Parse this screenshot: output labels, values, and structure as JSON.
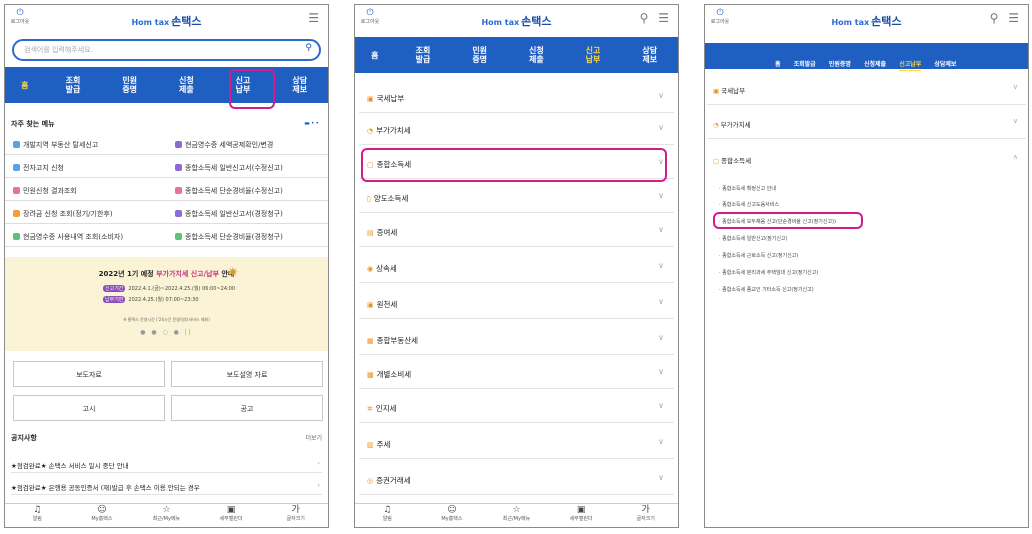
{
  "screen1": {
    "login_label": "로그아웃",
    "logo_text": "손택스",
    "logo_hometax": "Hom tax",
    "search_placeholder": "검색어를 입력해주세요.",
    "nav": [
      {
        "label": "홈"
      },
      {
        "label": "조회\n발급"
      },
      {
        "label": "민원\n증명"
      },
      {
        "label": "신청\n제출"
      },
      {
        "label": "신고\n납부"
      },
      {
        "label": "상담\n제보"
      }
    ],
    "frequent_title": "자주 찾는 메뉴",
    "frequent_menu": [
      {
        "label": "개발지역 부동산 탈세신고",
        "color": "#5aa0e6"
      },
      {
        "label": "현금영수증 세액공제확인/변경",
        "color": "#8c6bd6"
      },
      {
        "label": "전자고지 신청",
        "color": "#5aa0e6"
      },
      {
        "label": "종합소득세 일반신고서(수정신고)",
        "color": "#8c6bd6"
      },
      {
        "label": "민원신청 결과조회",
        "color": "#e86fa4"
      },
      {
        "label": "종합소득세 단순경비율(수정신고)",
        "color": "#e86fa4"
      },
      {
        "label": "장려금 신청 조회(정기/기한후)",
        "color": "#f0a040"
      },
      {
        "label": "종합소득세 일반신고서(경정청구)",
        "color": "#8c6bd6"
      },
      {
        "label": "현금영수증 사용내역 조회(소비자)",
        "color": "#5ec07a"
      },
      {
        "label": "종합소득세 단순경비율(경정청구)",
        "color": "#5ec07a"
      }
    ],
    "banner": {
      "title_prefix": "2022년 1기 예정 ",
      "title_highlight": "부가가치세 신고/납부",
      "title_suffix": " 안내",
      "line1_tag": "신고기간",
      "line1": "2022.4.1.(금)~2022.4.25.(월) 06:00~24:00",
      "line2_tag": "납부기한",
      "line2": "2022.4.25.(월) 07:00~23:30",
      "note": "※ 홈택스 운영시간 ('24시간 운영/일부서비스 제외)",
      "pager": "● ● ○ ● ||"
    },
    "buttons": [
      "보도자료",
      "보도설명 자료",
      "고시",
      "공고"
    ],
    "notice_title": "공지사항",
    "notice_more": "더보기",
    "notices": [
      "★점검완료★ 손택스 서비스 일시 중단 안내",
      "★점검완료★ 은행용 공동인증서 (재)발급 후 손택스 이용 안되는 경우"
    ]
  },
  "screen2": {
    "login_label": "로그아웃",
    "logo_text": "손택스",
    "logo_hometax": "Hom tax",
    "nav": [
      {
        "label": "홈"
      },
      {
        "label": "조회\n발급"
      },
      {
        "label": "민원\n증명"
      },
      {
        "label": "신청\n제출"
      },
      {
        "label": "신고\n납부"
      },
      {
        "label": "상담\n제보"
      }
    ],
    "items": [
      "국세납부",
      "부가가치세",
      "종합소득세",
      "양도소득세",
      "증여세",
      "상속세",
      "원천세",
      "종합부동산세",
      "개별소비세",
      "인지세",
      "주세",
      "증권거래세"
    ]
  },
  "screen3": {
    "login_label": "로그아웃",
    "logo_text": "손택스",
    "logo_hometax": "Hom tax",
    "nav": [
      "홈",
      "조회발급",
      "민원증명",
      "신청제출",
      "신고납부",
      "상담제보"
    ],
    "items": [
      "국세납부",
      "부가가치세",
      "종합소득세"
    ],
    "sub_items": [
      "· 종합소득세 확정신고 안내",
      "· 종합소득세 신고도움서비스",
      "· 종합소득세 모두채움 신고(단순경비율 신고(정기신고))",
      "· 종합소득세 일반신고(정기신고)",
      "· 종합소득세 근로소득 신고(정기신고)",
      "· 종합소득세 분리과세 주택임대 신고(정기신고)",
      "· 종합소득세 종교인 기타소득 신고(정기신고)"
    ]
  },
  "bottom_nav": [
    {
      "icon": "bell-icon",
      "label": "알림"
    },
    {
      "icon": "person-icon",
      "label": "My홈택스"
    },
    {
      "icon": "star-icon",
      "label": "최근/My메뉴"
    },
    {
      "icon": "calendar-icon",
      "label": "세무캘린더"
    },
    {
      "icon": "font-size-icon",
      "label": "글자크기"
    }
  ],
  "colors": {
    "nav_blue": "#1f5fc2",
    "active_yellow": "#ffd84a",
    "highlight_magenta": "#d11d8c"
  }
}
